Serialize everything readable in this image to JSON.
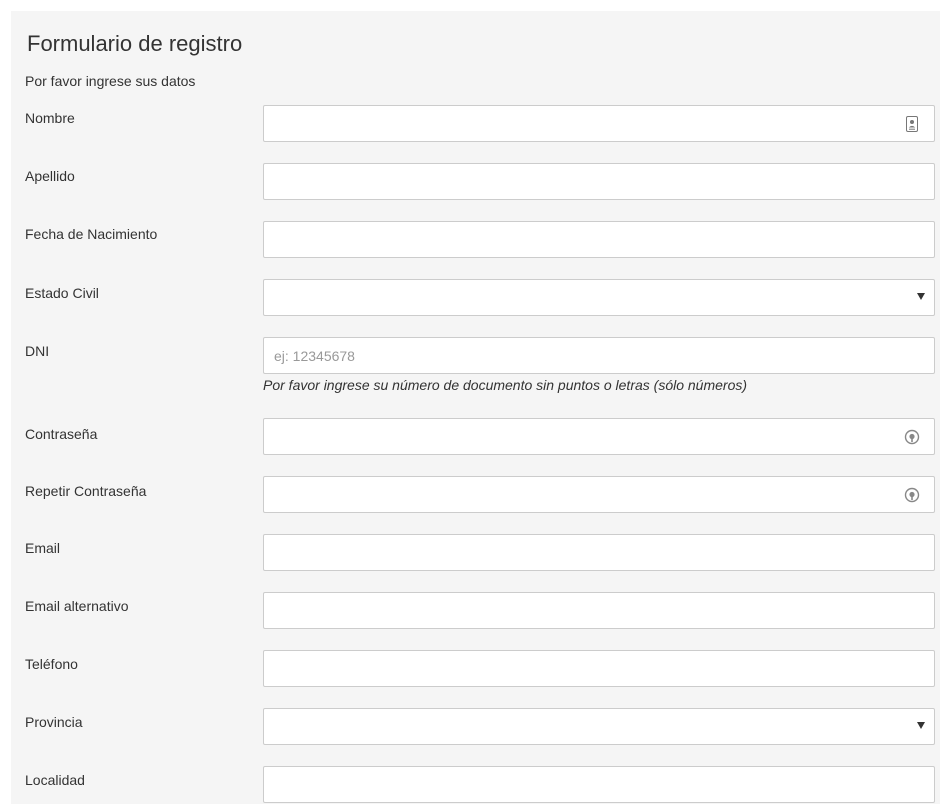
{
  "form": {
    "title": "Formulario de registro",
    "subtitle": "Por favor ingrese sus datos",
    "fields": [
      {
        "label": "Nombre",
        "type": "text",
        "value": "",
        "placeholder": "",
        "icon": "contact-card-icon"
      },
      {
        "label": "Apellido",
        "type": "text",
        "value": "",
        "placeholder": ""
      },
      {
        "label": "Fecha de Nacimiento",
        "type": "text",
        "value": "",
        "placeholder": ""
      },
      {
        "label": "Estado Civil",
        "type": "select",
        "value": ""
      },
      {
        "label": "DNI",
        "type": "text",
        "value": "",
        "placeholder": "ej: 12345678",
        "help": "Por favor ingrese su número de documento sin puntos o letras (sólo números)"
      },
      {
        "label": "Contraseña",
        "type": "password",
        "value": "",
        "placeholder": "",
        "icon": "password-manager-icon"
      },
      {
        "label": "Repetir Contraseña",
        "type": "password",
        "value": "",
        "placeholder": "",
        "icon": "password-manager-icon"
      },
      {
        "label": "Email",
        "type": "email",
        "value": "",
        "placeholder": ""
      },
      {
        "label": "Email alternativo",
        "type": "email",
        "value": "",
        "placeholder": ""
      },
      {
        "label": "Teléfono",
        "type": "text",
        "value": "",
        "placeholder": ""
      },
      {
        "label": "Provincia",
        "type": "select",
        "value": ""
      },
      {
        "label": "Localidad",
        "type": "text",
        "value": "",
        "placeholder": ""
      }
    ]
  },
  "colors": {
    "panel_background": "#f5f5f5",
    "input_border": "#cccccc",
    "text": "#333333",
    "placeholder": "#999999"
  }
}
